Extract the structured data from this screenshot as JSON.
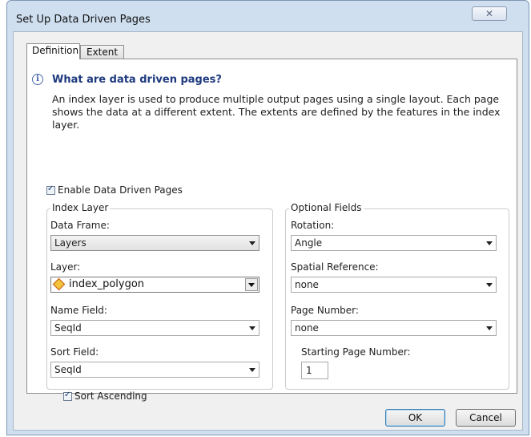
{
  "window": {
    "title": "Set Up Data Driven Pages",
    "close_glyph": "✕"
  },
  "tabs": [
    {
      "label": "Definition",
      "active": true
    },
    {
      "label": "Extent",
      "active": false
    }
  ],
  "info": {
    "icon": "info-icon",
    "icon_glyph": "i",
    "title": "What are data driven pages?",
    "description": "An index layer is used to produce multiple output pages using a single layout.  Each page shows the data at a different extent.  The extents are defined by the features in the index layer."
  },
  "enable": {
    "label": "Enable Data Driven Pages",
    "checked": true
  },
  "index_layer": {
    "legend": "Index Layer",
    "data_frame": {
      "label": "Data Frame:",
      "value": "Layers"
    },
    "layer": {
      "label": "Layer:",
      "value": "index_polygon",
      "icon": "polygon-layer-icon"
    },
    "name_field": {
      "label": "Name Field:",
      "value": "SeqId"
    },
    "sort_field": {
      "label": "Sort Field:",
      "value": "SeqId"
    },
    "sort_ascending": {
      "label": "Sort Ascending",
      "checked": true
    }
  },
  "optional_fields": {
    "legend": "Optional Fields",
    "rotation": {
      "label": "Rotation:",
      "value": "Angle"
    },
    "spatial_reference": {
      "label": "Spatial Reference:",
      "value": "none"
    },
    "page_number": {
      "label": "Page Number:",
      "value": "none"
    },
    "starting_page_number": {
      "label": "Starting Page Number:",
      "value": "1"
    }
  },
  "buttons": {
    "ok": "OK",
    "cancel": "Cancel"
  }
}
